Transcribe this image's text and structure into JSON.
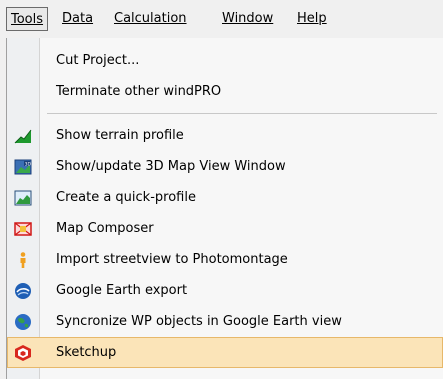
{
  "menubar": {
    "items": [
      {
        "key": "tools",
        "label": "Tools"
      },
      {
        "key": "data",
        "label": "Data"
      },
      {
        "key": "calculation",
        "label": "Calculation"
      },
      {
        "key": "window",
        "label": "Window"
      },
      {
        "key": "help",
        "label": "Help"
      }
    ]
  },
  "menu": {
    "items": [
      {
        "label": "Cut Project...",
        "icon": null
      },
      {
        "label": "Terminate other windPRO",
        "icon": null
      },
      {
        "label": "Show terrain profile",
        "icon": "terrain-profile-icon"
      },
      {
        "label": "Show/update 3D Map View Window",
        "icon": "3d-map-icon"
      },
      {
        "label": "Create a quick-profile",
        "icon": "quick-profile-icon"
      },
      {
        "label": "Map Composer",
        "icon": "map-composer-icon"
      },
      {
        "label": "Import streetview to Photomontage",
        "icon": "streetview-person-icon"
      },
      {
        "label": "Google Earth export",
        "icon": "google-earth-icon"
      },
      {
        "label": "Syncronize WP objects in Google Earth view",
        "icon": "sync-globe-icon"
      },
      {
        "label": "Sketchup",
        "icon": "sketchup-icon"
      }
    ]
  },
  "colors": {
    "highlight": "#fbe4b8",
    "menubar_bg": "#f0f0f0"
  }
}
